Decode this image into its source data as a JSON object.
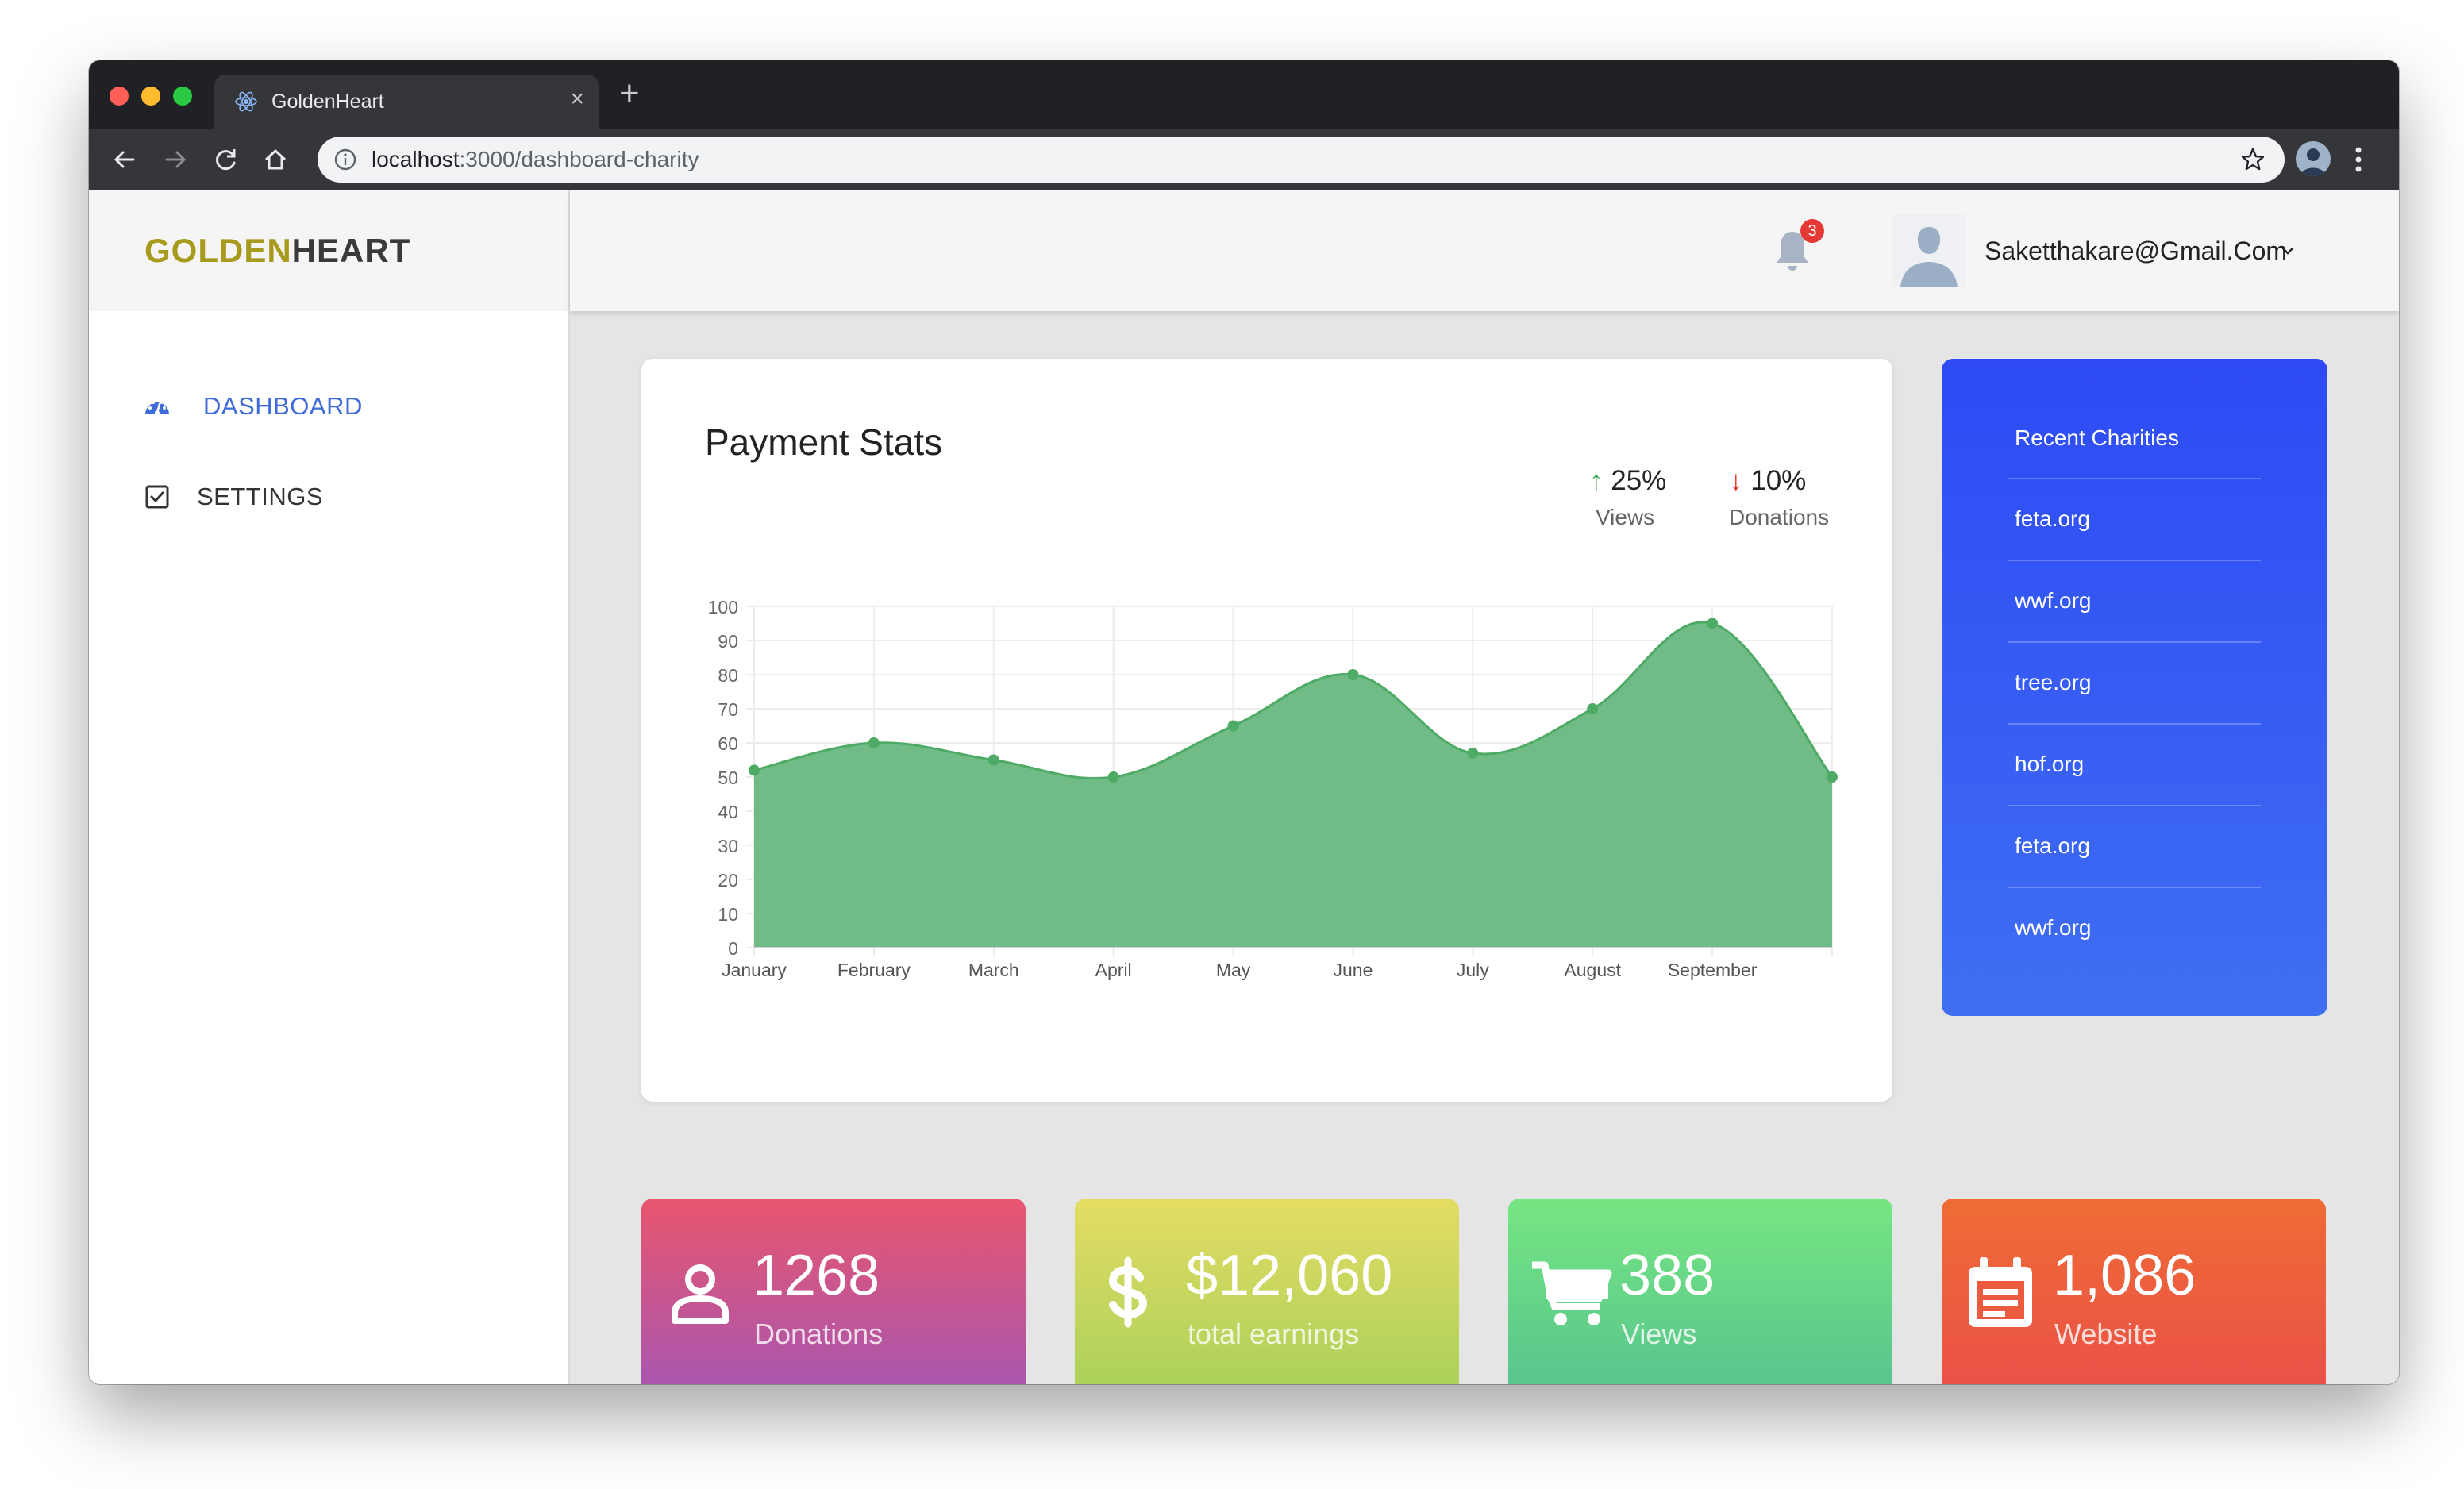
{
  "browser": {
    "tab_title": "GoldenHeart",
    "new_tab_label": "+",
    "close_label": "×",
    "url_host": "localhost",
    "url_path": ":3000/dashboard-charity"
  },
  "brand": {
    "part1": "GOLDEN",
    "part2": "HEART"
  },
  "topbar": {
    "notification_count": "3",
    "user_email": "Saketthakare@Gmail.Com"
  },
  "sidebar": {
    "items": [
      {
        "label": "DASHBOARD",
        "icon": "dashboard-gauge-icon",
        "active": true,
        "color": "#3f6bd8"
      },
      {
        "label": "SETTINGS",
        "icon": "checkbox-icon",
        "active": false,
        "color": "#333333"
      }
    ]
  },
  "payment_stats": {
    "title": "Payment Stats",
    "stats": [
      {
        "value": "25%",
        "label": "Views",
        "direction": "up",
        "arrow": "↑"
      },
      {
        "value": "10%",
        "label": "Donations",
        "direction": "down",
        "arrow": "↓"
      }
    ]
  },
  "chart_data": {
    "type": "area",
    "categories": [
      "January",
      "February",
      "March",
      "April",
      "May",
      "June",
      "July",
      "August",
      "September",
      ""
    ],
    "values": [
      52,
      60,
      55,
      50,
      65,
      80,
      57,
      70,
      95,
      50
    ],
    "ylim": [
      0,
      100
    ],
    "yticks": [
      "0",
      "10",
      "20",
      "30",
      "40",
      "50",
      "60",
      "70",
      "80",
      "90",
      "100"
    ],
    "grid": true,
    "fill_color": "#6dba84",
    "point_color": "#4eab66"
  },
  "recent_charities": {
    "title": "Recent Charities",
    "items": [
      "feta.org",
      "wwf.org",
      "tree.org",
      "hof.org",
      "feta.org",
      "wwf.org"
    ]
  },
  "tiles": [
    {
      "value": "1268",
      "label": "Donations",
      "icon": "user-icon"
    },
    {
      "value": "$12,060",
      "label": "total earnings",
      "icon": "dollar-icon"
    },
    {
      "value": "388",
      "label": "Views",
      "icon": "cart-icon"
    },
    {
      "value": "1,086",
      "label": "Website",
      "icon": "calendar-icon"
    }
  ]
}
